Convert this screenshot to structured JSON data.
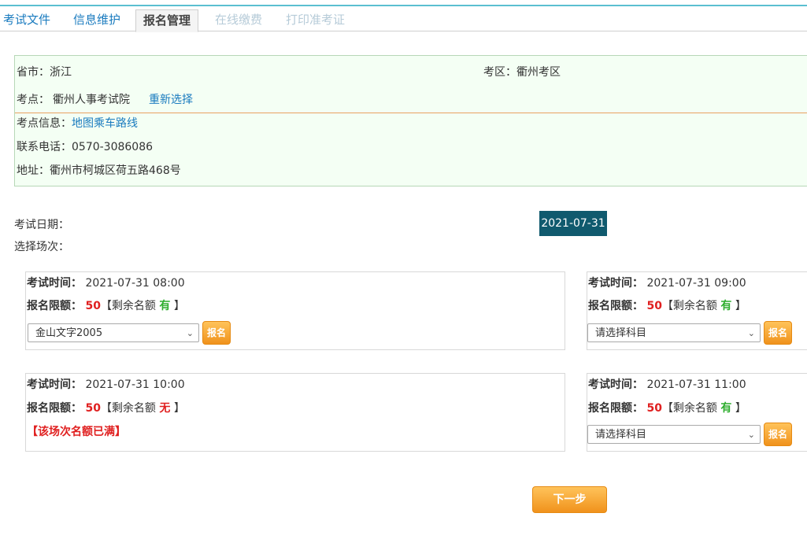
{
  "tabs": [
    "考试文件",
    "信息维护",
    "报名管理",
    "在线缴费",
    "打印准考证"
  ],
  "info": {
    "province_label": "省市：",
    "province": "浙江",
    "district_label": "考区：",
    "district": "衢州考区",
    "site_label": "考点：",
    "site": "衢州人事考试院",
    "reselect": "重新选择",
    "siteinfo_label": "考点信息：",
    "map_link": "地图乘车路线",
    "phone_label": "联系电话：",
    "phone": "0570-3086086",
    "address_label": "地址：",
    "address": "衢州市柯城区荷五路468号"
  },
  "exam_date_label": "考试日期：",
  "exam_date": "2021-07-31",
  "session_label": "选择场次：",
  "sessions": [
    {
      "time_label": "考试时间：",
      "time": "2021-07-31 08:00",
      "quota_label": "报名限额：",
      "quota": "50",
      "remain_open": "【剩余名额",
      "remain": "有",
      "remain_close": "】",
      "select": "金山文字2005",
      "signup": "报名"
    },
    {
      "time_label": "考试时间：",
      "time": "2021-07-31 09:00",
      "quota_label": "报名限额：",
      "quota": "50",
      "remain_open": "【剩余名额",
      "remain": "有",
      "remain_close": "】",
      "select": "请选择科目",
      "signup": "报名"
    },
    {
      "time_label": "考试时间：",
      "time": "2021-07-31 10:00",
      "quota_label": "报名限额：",
      "quota": "50",
      "remain_open": "【剩余名额",
      "remain": "无",
      "remain_close": "】",
      "full_msg": "【该场次名额已满】"
    },
    {
      "time_label": "考试时间：",
      "time": "2021-07-31 11:00",
      "quota_label": "报名限额：",
      "quota": "50",
      "remain_open": "【剩余名额",
      "remain": "有",
      "remain_close": "】",
      "select": "请选择科目",
      "signup": "报名"
    }
  ],
  "next_button": "下一步",
  "colors": {
    "accent": "#1a7bbf",
    "date_bg": "#105a6e",
    "button": "#f0921c",
    "red": "#e02020",
    "green": "#2fae2f",
    "info_bg": "#f4fff4"
  }
}
